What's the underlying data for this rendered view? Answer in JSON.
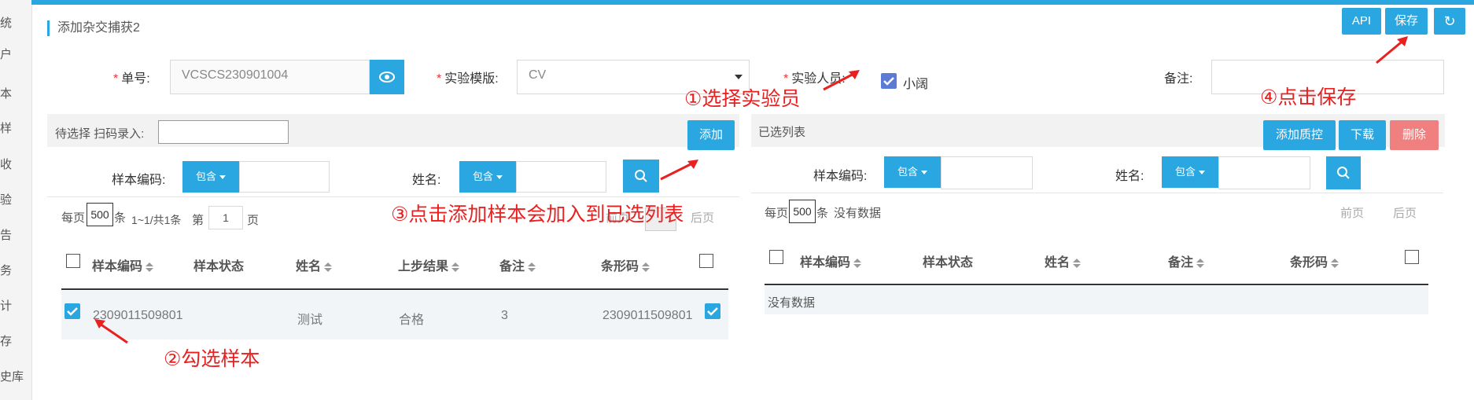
{
  "sidebar": {
    "items": [
      "统",
      "户",
      "本",
      "样",
      "收",
      "验",
      "告",
      "务",
      "计",
      "存",
      "史库"
    ]
  },
  "header": {
    "title": "添加杂交捕获2",
    "api_label": "API",
    "save_label": "保存",
    "refresh_icon": "refresh-icon"
  },
  "form": {
    "order_no_label": "单号:",
    "order_no_value": "VCSCS230901004",
    "template_label": "实验模版:",
    "template_value": "CV",
    "staff_label": "实验人员:",
    "staff_value": "小阔",
    "remark_label": "备注:",
    "remark_value": ""
  },
  "left_panel": {
    "scan_label": "待选择 扫码录入:",
    "add_label": "添加",
    "filter_code_label": "样本编码:",
    "filter_name_label": "姓名:",
    "contains_label": "包含",
    "pager_per_page": "每页",
    "pager_size": "500",
    "pager_unit": "条",
    "pager_info": "1~1/共1条",
    "pager_page_prefix": "第",
    "pager_page_value": "1",
    "pager_page_suffix": "页",
    "prev_label": "前页",
    "next_label": "后页",
    "columns": [
      "样本编码",
      "样本状态",
      "姓名",
      "上步结果",
      "备注",
      "条形码"
    ],
    "row": {
      "code": "2309011509801",
      "status": "",
      "name": "测试",
      "result": "合格",
      "remark": "3",
      "barcode": "2309011509801"
    }
  },
  "right_panel": {
    "title": "已选列表",
    "add_qc_label": "添加质控",
    "download_label": "下载",
    "delete_label": "删除",
    "filter_code_label": "样本编码:",
    "filter_name_label": "姓名:",
    "contains_label": "包含",
    "pager_per_page": "每页",
    "pager_size": "500",
    "pager_unit": "条",
    "pager_info": "没有数据",
    "prev_label": "前页",
    "next_label": "后页",
    "columns": [
      "样本编码",
      "样本状态",
      "姓名",
      "备注",
      "条形码"
    ],
    "empty_text": "没有数据"
  },
  "annotations": {
    "step1": "①选择实验员",
    "step2": "②勾选样本",
    "step3": "③点击添加样本会加入到已选列表",
    "step4": "④点击保存"
  },
  "colors": {
    "accent": "#2aa6e0",
    "delete": "#f08080",
    "annotation": "#e82020"
  }
}
